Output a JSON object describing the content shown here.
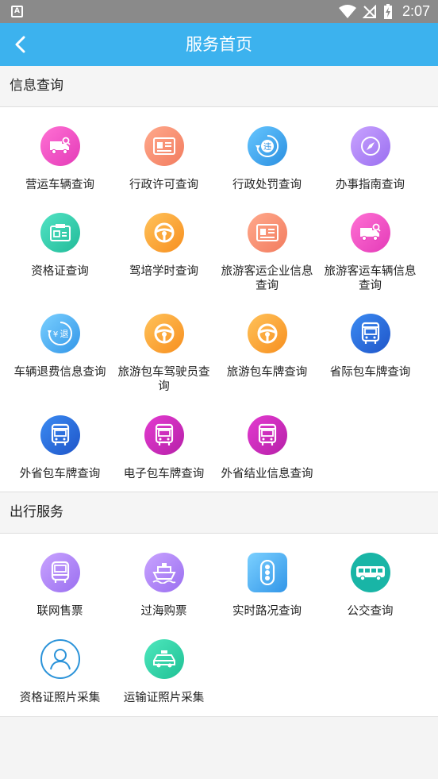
{
  "status_bar": {
    "time": "2:07",
    "notification_icon": "A"
  },
  "app_bar": {
    "title": "服务首页",
    "back_icon": "chevron-left-icon"
  },
  "sections": [
    {
      "title": "信息查询",
      "items": [
        {
          "label": "营运车辆查询",
          "icon": "truck-search-icon"
        },
        {
          "label": "行政许可查询",
          "icon": "license-card-icon"
        },
        {
          "label": "行政处罚查询",
          "icon": "violation-icon"
        },
        {
          "label": "办事指南查询",
          "icon": "compass-icon"
        },
        {
          "label": "资格证查询",
          "icon": "certificate-icon"
        },
        {
          "label": "驾培学时查询",
          "icon": "steering-wheel-icon"
        },
        {
          "label": "旅游客运企业信息查询",
          "icon": "license-card-icon"
        },
        {
          "label": "旅游客运车辆信息查询",
          "icon": "truck-search-icon"
        },
        {
          "label": "车辆退费信息查询",
          "icon": "refund-icon"
        },
        {
          "label": "旅游包车驾驶员查询",
          "icon": "steering-wheel-icon"
        },
        {
          "label": "旅游包车牌查询",
          "icon": "steering-wheel-icon"
        },
        {
          "label": "省际包车牌查询",
          "icon": "bus-icon"
        },
        {
          "label": "外省包车牌查询",
          "icon": "bus-icon"
        },
        {
          "label": "电子包车牌查询",
          "icon": "bus-icon"
        },
        {
          "label": "外省结业信息查询",
          "icon": "bus-icon"
        }
      ]
    },
    {
      "title": "出行服务",
      "items": [
        {
          "label": "联网售票",
          "icon": "coach-icon"
        },
        {
          "label": "过海购票",
          "icon": "ship-icon"
        },
        {
          "label": "实时路况查询",
          "icon": "traffic-light-icon"
        },
        {
          "label": "公交查询",
          "icon": "city-bus-icon"
        },
        {
          "label": "资格证照片采集",
          "icon": "person-icon"
        },
        {
          "label": "运输证照片采集",
          "icon": "taxi-icon"
        }
      ]
    }
  ]
}
